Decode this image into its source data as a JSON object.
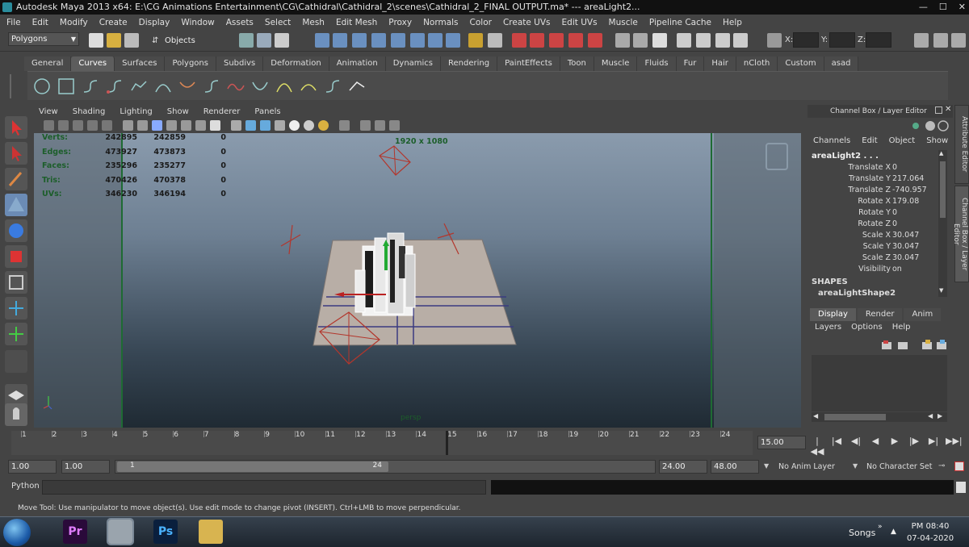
{
  "window": {
    "title": "Autodesk Maya 2013 x64: E:\\CG Animations Entertainment\\CG\\Cathidral\\Cathidral_2\\scenes\\Cathidral_2_FINAL OUTPUT.ma*    ---    areaLight2...",
    "minimize": "—",
    "maximize": "☐",
    "close": "✕"
  },
  "menubar": [
    "File",
    "Edit",
    "Modify",
    "Create",
    "Display",
    "Window",
    "Assets",
    "Select",
    "Mesh",
    "Edit Mesh",
    "Proxy",
    "Normals",
    "Color",
    "Create UVs",
    "Edit UVs",
    "Muscle",
    "Pipeline Cache",
    "Help"
  ],
  "statusline": {
    "menuset": "Polygons",
    "selmode": "Objects",
    "x_label": "X:",
    "y_label": "Y:",
    "z_label": "Z:"
  },
  "shelf_tabs": [
    {
      "label": "General"
    },
    {
      "label": "Curves",
      "active": true
    },
    {
      "label": "Surfaces"
    },
    {
      "label": "Polygons"
    },
    {
      "label": "Subdivs"
    },
    {
      "label": "Deformation"
    },
    {
      "label": "Animation"
    },
    {
      "label": "Dynamics"
    },
    {
      "label": "Rendering"
    },
    {
      "label": "PaintEffects"
    },
    {
      "label": "Toon"
    },
    {
      "label": "Muscle"
    },
    {
      "label": "Fluids"
    },
    {
      "label": "Fur"
    },
    {
      "label": "Hair"
    },
    {
      "label": "nCloth"
    },
    {
      "label": "Custom"
    },
    {
      "label": "asad"
    }
  ],
  "viewport": {
    "menu": [
      "View",
      "Shading",
      "Lighting",
      "Show",
      "Renderer",
      "Panels"
    ],
    "resolution_gate": "1920 x 1080",
    "camera_label": "persp",
    "hud": [
      {
        "label": "Verts:",
        "v1": "242895",
        "v2": "242859",
        "v3": "0"
      },
      {
        "label": "Edges:",
        "v1": "473927",
        "v2": "473873",
        "v3": "0"
      },
      {
        "label": "Faces:",
        "v1": "235296",
        "v2": "235277",
        "v3": "0"
      },
      {
        "label": "Tris:",
        "v1": "470426",
        "v2": "470378",
        "v3": "0"
      },
      {
        "label": "UVs:",
        "v1": "346230",
        "v2": "346194",
        "v3": "0"
      }
    ]
  },
  "channel_box": {
    "header": "Channel Box / Layer Editor",
    "menu": [
      "Channels",
      "Edit",
      "Object",
      "Show"
    ],
    "object": "areaLight2 . . .",
    "channels": [
      {
        "name": "Translate X",
        "value": "0"
      },
      {
        "name": "Translate Y",
        "value": "217.064"
      },
      {
        "name": "Translate Z",
        "value": "-740.957"
      },
      {
        "name": "Rotate X",
        "value": "179.08"
      },
      {
        "name": "Rotate Y",
        "value": "0"
      },
      {
        "name": "Rotate Z",
        "value": "0"
      },
      {
        "name": "Scale X",
        "value": "30.047"
      },
      {
        "name": "Scale Y",
        "value": "30.047"
      },
      {
        "name": "Scale Z",
        "value": "30.047"
      },
      {
        "name": "Visibility",
        "value": "on"
      }
    ],
    "shapes_label": "SHAPES",
    "shape_name": "areaLightShape2"
  },
  "side_tabs": [
    "Attribute Editor",
    "Channel Box / Layer Editor"
  ],
  "layer_editor": {
    "tabs": [
      {
        "label": "Display",
        "active": true
      },
      {
        "label": "Render"
      },
      {
        "label": "Anim"
      }
    ],
    "menu": [
      "Layers",
      "Options",
      "Help"
    ]
  },
  "time_slider": {
    "ticks": [
      "1",
      "2",
      "3",
      "4",
      "5",
      "6",
      "7",
      "8",
      "9",
      "10",
      "11",
      "12",
      "13",
      "14",
      "15",
      "16",
      "17",
      "18",
      "19",
      "20",
      "21",
      "22",
      "23",
      "24"
    ],
    "current_frame": "15.00",
    "playback": [
      "|◀◀",
      "|◀",
      "◀|",
      "◀",
      "▶",
      "|▶",
      "▶|",
      "▶▶|"
    ]
  },
  "range_slider": {
    "start_time": "1.00",
    "playback_start": "1.00",
    "range_start_label": "1",
    "range_end_label": "24",
    "playback_end": "24.00",
    "end_time": "48.00",
    "anim_layer": "No Anim Layer",
    "character_set": "No Character Set"
  },
  "command_line": {
    "language": "Python"
  },
  "help_line": "Move Tool: Use manipulator to move object(s). Use edit mode to change pivot (INSERT).  Ctrl+LMB to move perpendicular.",
  "taskbar": {
    "apps": [
      {
        "name": "premiere",
        "label": "Pr",
        "color": "#2a0a3a",
        "text": "#e07cff"
      },
      {
        "name": "maya",
        "label": "",
        "color": "#9aa4ad",
        "text": "#333"
      },
      {
        "name": "photoshop",
        "label": "Ps",
        "color": "#0a1f3d",
        "text": "#4ab2ff"
      },
      {
        "name": "explorer",
        "label": "",
        "color": "#d8b450",
        "text": "#333"
      }
    ],
    "tray_label": "Songs",
    "tray_chevron": "»",
    "tray_up": "▲",
    "time": "PM 08:40",
    "date": "07-04-2020"
  }
}
